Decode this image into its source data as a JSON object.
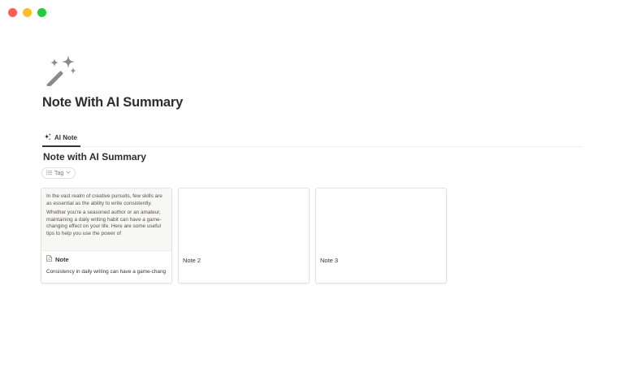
{
  "window": {
    "controls": [
      "close",
      "minimize",
      "zoom"
    ]
  },
  "page": {
    "icon": "magic-wand-sparkles-icon",
    "title": "Note With AI Summary"
  },
  "tabs": [
    {
      "label": "AI Note",
      "icon": "sparkles-icon",
      "active": true
    }
  ],
  "database": {
    "title": "Note with AI Summary",
    "filter": {
      "label": "Tag",
      "icon": "list-icon",
      "chevron": "chevron-down-icon"
    }
  },
  "cards": [
    {
      "preview": [
        "In the vast realm of creative pursuits, few skills are as essential as the ability to write consistently.",
        "Whether you're a seasoned author or an amateur, maintaining a daily writing habit can have a game-changing effect on your life. Here are some useful tips to help you use the power of"
      ],
      "title": "Note",
      "icon": "page-icon",
      "summary": "Consistency in daily writing can have a game-chang"
    },
    {
      "title": "Note 2"
    },
    {
      "title": "Note 3"
    }
  ]
}
